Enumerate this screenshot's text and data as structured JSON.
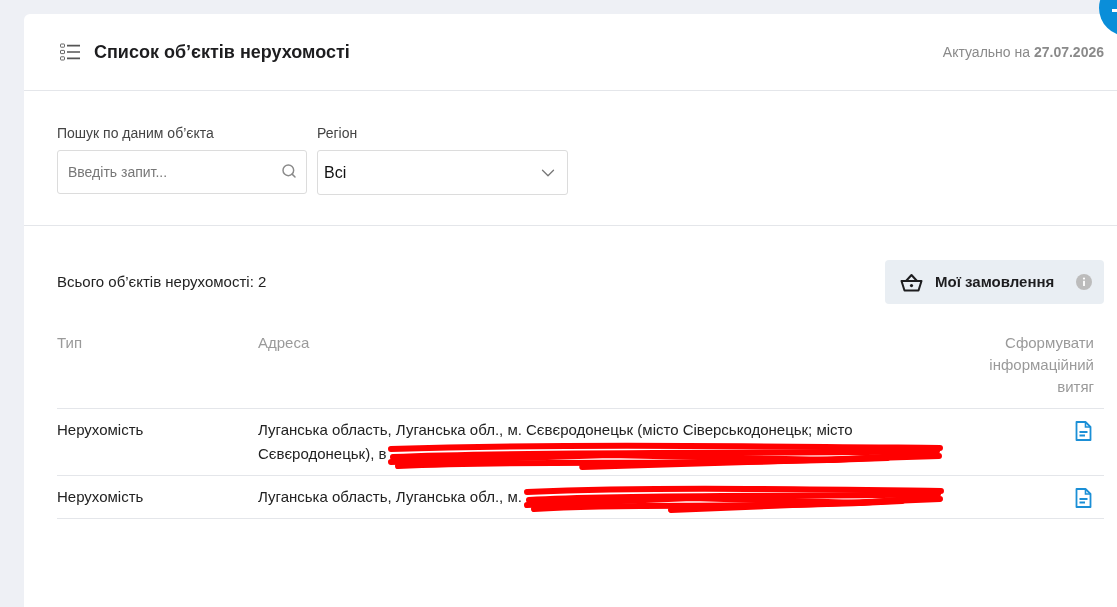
{
  "header": {
    "title": "Список об’єктів нерухомості",
    "updated": "Актуально на **27.07.2026**"
  },
  "filters": {
    "search": {
      "label": "Пошук по даним об’єкта",
      "placeholder": "Введіть запит..."
    },
    "region": {
      "label": "Регіон",
      "value": "Всі"
    }
  },
  "summary": {
    "total": "Всього об’єктів нерухомості: 2"
  },
  "orders_button": {
    "label": "Мої замовлення"
  },
  "table": {
    "columns": [
      "Тип",
      "Адреса",
      "Сформувати інформаційний витяг"
    ],
    "rows": [
      {
        "type": "Нерухомість",
        "address": "Луганська область, Луганська обл., м. Сєвєродонецьк (місто Сіверськодонецьк; місто Сєвєродонецьк), в",
        "redacted": true
      },
      {
        "type": "Нерухомість",
        "address": "Луганська область, Луганська обл., м.",
        "redacted": true
      }
    ]
  }
}
